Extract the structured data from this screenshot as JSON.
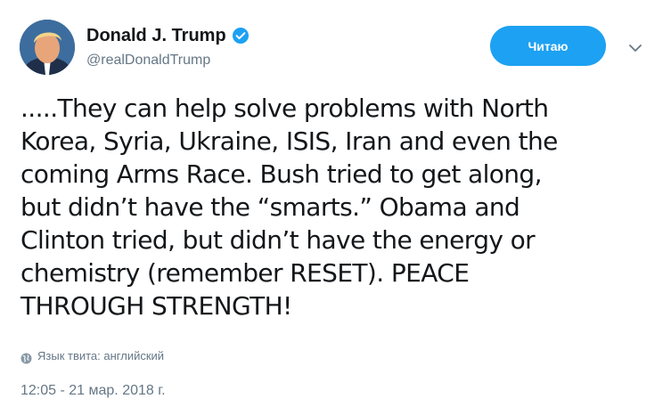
{
  "author": {
    "display_name": "Donald J. Trump",
    "handle": "@realDonaldTrump",
    "verified": true
  },
  "follow_button": {
    "label": "Читаю"
  },
  "tweet": {
    "text": ".....They can help solve problems with North\nKorea, Syria, Ukraine, ISIS, Iran and even the\ncoming Arms Race. Bush tried to get along,\nbut didn’t have the “smarts.” Obama and\nClinton tried, but didn’t have the energy or\nchemistry (remember RESET). PEACE\nTHROUGH STRENGTH!",
    "language_label": "Язык твита: английский",
    "timestamp": "12:05 - 21 мар. 2018 г."
  },
  "icons": {
    "verified": "verified-badge-icon",
    "caret": "chevron-down-icon",
    "language": "globe-icon"
  },
  "colors": {
    "accent": "#1da1f2",
    "text": "#14171a",
    "secondary_text": "#657786"
  }
}
